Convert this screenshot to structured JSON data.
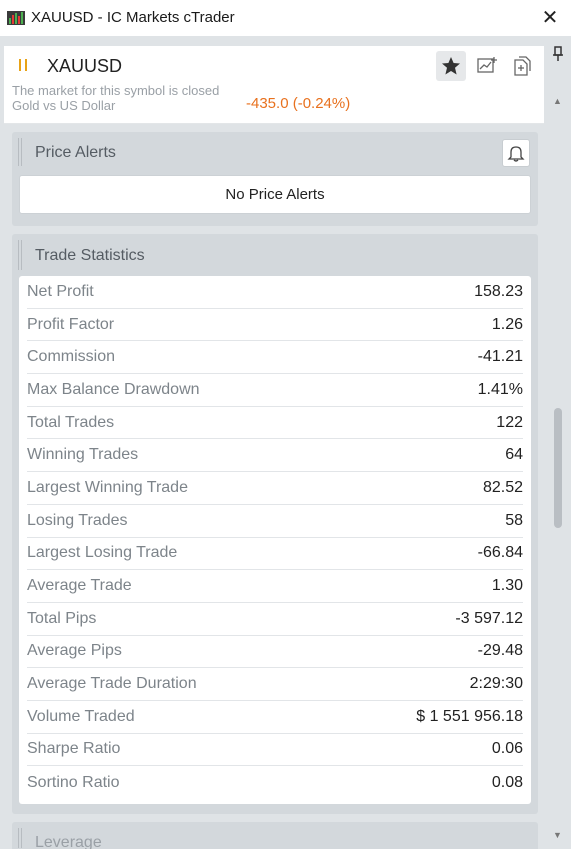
{
  "window": {
    "title": "XAUUSD - IC Markets cTrader",
    "app_icon": "ctrader-app-icon",
    "close_label": "✕"
  },
  "symbol": {
    "name": "XAUUSD",
    "market_status": "The market for this symbol is closed",
    "description": "Gold vs US Dollar",
    "price_change": "-435.0 (-0.24%)",
    "status_icon": "pause-icon",
    "price_change_color": "#e8711e"
  },
  "price_alerts": {
    "title": "Price Alerts",
    "empty_text": "No Price Alerts"
  },
  "trade_statistics": {
    "title": "Trade Statistics",
    "rows": [
      {
        "label": "Net Profit",
        "value": "158.23"
      },
      {
        "label": "Profit Factor",
        "value": "1.26"
      },
      {
        "label": "Commission",
        "value": "-41.21"
      },
      {
        "label": "Max Balance Drawdown",
        "value": "1.41%"
      },
      {
        "label": "Total Trades",
        "value": "122"
      },
      {
        "label": "Winning Trades",
        "value": "64"
      },
      {
        "label": "Largest Winning Trade",
        "value": "82.52"
      },
      {
        "label": "Losing Trades",
        "value": "58"
      },
      {
        "label": "Largest Losing Trade",
        "value": "-66.84"
      },
      {
        "label": "Average Trade",
        "value": "1.30"
      },
      {
        "label": "Total Pips",
        "value": "-3 597.12"
      },
      {
        "label": "Average Pips",
        "value": "-29.48"
      },
      {
        "label": "Average Trade Duration",
        "value": "2:29:30"
      },
      {
        "label": "Volume Traded",
        "value": "$ 1 551 956.18"
      },
      {
        "label": "Sharpe Ratio",
        "value": "0.06"
      },
      {
        "label": "Sortino Ratio",
        "value": "0.08"
      }
    ]
  },
  "leverage": {
    "title": "Leverage"
  }
}
